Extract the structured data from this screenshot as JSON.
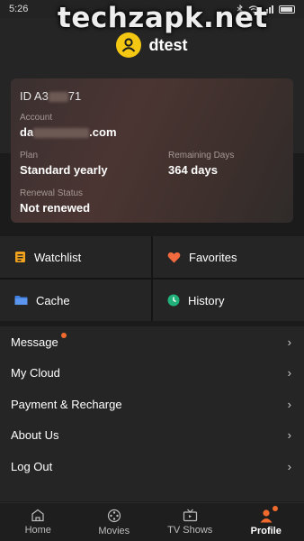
{
  "status_bar": {
    "time": "5:26"
  },
  "watermark": "techzapk.net",
  "profile": {
    "username": "dtest"
  },
  "account_card": {
    "id_prefix": "ID A3",
    "id_suffix": "71",
    "account_label": "Account",
    "account_prefix": "da",
    "account_suffix": ".com",
    "plan_label": "Plan",
    "plan_value": "Standard yearly",
    "remaining_label": "Remaining Days",
    "remaining_value": "364 days",
    "renewal_label": "Renewal Status",
    "renewal_value": "Not renewed"
  },
  "quick_tiles": [
    {
      "label": "Watchlist",
      "icon": "watchlist-icon",
      "color": "#f0a21c"
    },
    {
      "label": "Favorites",
      "icon": "heart-icon",
      "color": "#f26a3d"
    },
    {
      "label": "Cache",
      "icon": "folder-icon",
      "color": "#3f7fe0"
    },
    {
      "label": "History",
      "icon": "history-icon",
      "color": "#22b07a"
    }
  ],
  "menu": [
    {
      "label": "Message",
      "badge": true
    },
    {
      "label": "My Cloud"
    },
    {
      "label": "Payment & Recharge"
    },
    {
      "label": "About Us"
    },
    {
      "label": "Log Out"
    }
  ],
  "tabs": [
    {
      "label": "Home",
      "icon": "home-icon"
    },
    {
      "label": "Movies",
      "icon": "film-reel-icon"
    },
    {
      "label": "TV Shows",
      "icon": "tv-icon"
    },
    {
      "label": "Profile",
      "icon": "person-icon",
      "active": true,
      "badge": true
    }
  ],
  "colors": {
    "accent": "#f06a2d",
    "avatar": "#f4c713",
    "background": "#1b1b1b",
    "panel": "#252525"
  }
}
